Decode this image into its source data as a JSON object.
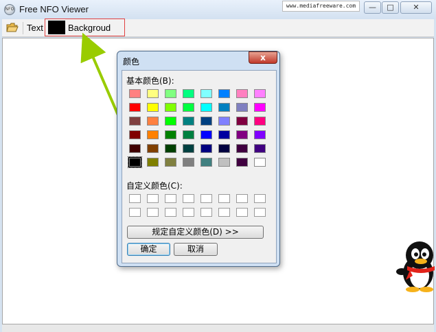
{
  "window": {
    "title": "Free NFO Viewer",
    "app_icon_text": "NFO",
    "watermark": "www.mediafreeware.com",
    "controls": {
      "minimize": "—",
      "maximize": "□",
      "close": "✕"
    }
  },
  "toolbar": {
    "open_icon": "folder-open-icon",
    "text_label": "Text",
    "background_label": "Backgroud",
    "background_color": "#000000"
  },
  "dialog": {
    "title": "颜色",
    "close_label": "x",
    "basic_colors_label": "基本颜色(B):",
    "basic_colors": [
      [
        "#ff8080",
        "#ffff80",
        "#80ff80",
        "#00ff80",
        "#80ffff",
        "#0080ff",
        "#ff80c0",
        "#ff80ff"
      ],
      [
        "#ff0000",
        "#ffff00",
        "#80ff00",
        "#00ff40",
        "#00ffff",
        "#0080c0",
        "#8080c0",
        "#ff00ff"
      ],
      [
        "#804040",
        "#ff8040",
        "#00ff00",
        "#008080",
        "#004080",
        "#8080ff",
        "#800040",
        "#ff0080"
      ],
      [
        "#800000",
        "#ff8000",
        "#008000",
        "#008040",
        "#0000ff",
        "#0000a0",
        "#800080",
        "#8000ff"
      ],
      [
        "#400000",
        "#804000",
        "#004000",
        "#004040",
        "#000080",
        "#000040",
        "#400040",
        "#400080"
      ],
      [
        "#000000",
        "#808000",
        "#808040",
        "#808080",
        "#408080",
        "#c0c0c0",
        "#400040",
        "#ffffff"
      ]
    ],
    "selected_color": "#000000",
    "custom_colors_label": "自定义颜色(C):",
    "define_custom_label": "规定自定义颜色(D) >>",
    "ok_label": "确定",
    "cancel_label": "取消"
  }
}
